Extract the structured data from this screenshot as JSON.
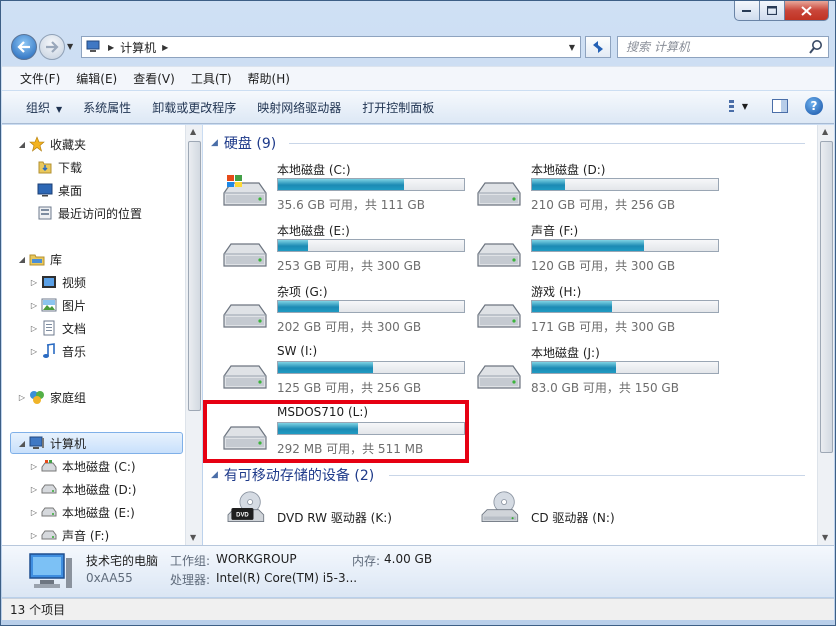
{
  "address": {
    "crumb": "计算机"
  },
  "search": {
    "placeholder": "搜索 计算机"
  },
  "menu": [
    "文件(F)",
    "编辑(E)",
    "查看(V)",
    "工具(T)",
    "帮助(H)"
  ],
  "commands": {
    "organize": "组织",
    "items": [
      "系统属性",
      "卸载或更改程序",
      "映射网络驱动器",
      "打开控制面板"
    ]
  },
  "nav": {
    "favorites": "收藏夹",
    "downloads": "下载",
    "desktop": "桌面",
    "recent": "最近访问的位置",
    "libraries": "库",
    "videos": "视频",
    "pictures": "图片",
    "documents": "文档",
    "music": "音乐",
    "homegroup": "家庭组",
    "computer": "计算机",
    "drives": [
      "本地磁盘 (C:)",
      "本地磁盘 (D:)",
      "本地磁盘 (E:)",
      "声音 (F:)"
    ]
  },
  "groups": {
    "hdd": "硬盘 (9)",
    "removable": "有可移动存储的设备 (2)"
  },
  "drives": [
    {
      "name": "本地磁盘 (C:)",
      "info": "35.6 GB 可用，共 111 GB",
      "used": 0.68
    },
    {
      "name": "本地磁盘 (D:)",
      "info": "210 GB 可用，共 256 GB",
      "used": 0.18
    },
    {
      "name": "本地磁盘 (E:)",
      "info": "253 GB 可用，共 300 GB",
      "used": 0.16
    },
    {
      "name": "声音 (F:)",
      "info": "120 GB 可用，共 300 GB",
      "used": 0.6
    },
    {
      "name": "杂项 (G:)",
      "info": "202 GB 可用，共 300 GB",
      "used": 0.33
    },
    {
      "name": "游戏 (H:)",
      "info": "171 GB 可用，共 300 GB",
      "used": 0.43
    },
    {
      "name": "SW (I:)",
      "info": "125 GB 可用，共 256 GB",
      "used": 0.51
    },
    {
      "name": "本地磁盘 (J:)",
      "info": "83.0 GB 可用，共 150 GB",
      "used": 0.45
    },
    {
      "name": "MSDOS710 (L:)",
      "info": "292 MB 可用，共 511 MB",
      "used": 0.43
    }
  ],
  "optical": [
    {
      "name": "DVD RW 驱动器 (K:)",
      "badge": "DVD"
    },
    {
      "name": "CD 驱动器 (N:)"
    }
  ],
  "details": {
    "computer_name": "技术宅的电脑",
    "id": "0xAA55",
    "workgroup_label": "工作组:",
    "workgroup": "WORKGROUP",
    "memory_label": "内存:",
    "memory": "4.00 GB",
    "cpu_label": "处理器:",
    "cpu": "Intel(R) Core(TM) i5-3..."
  },
  "status": "13 个项目",
  "colors": {
    "bar_fill": "#1f9bc3",
    "highlight": "#e60012",
    "group_text": "#1e3a8a"
  }
}
